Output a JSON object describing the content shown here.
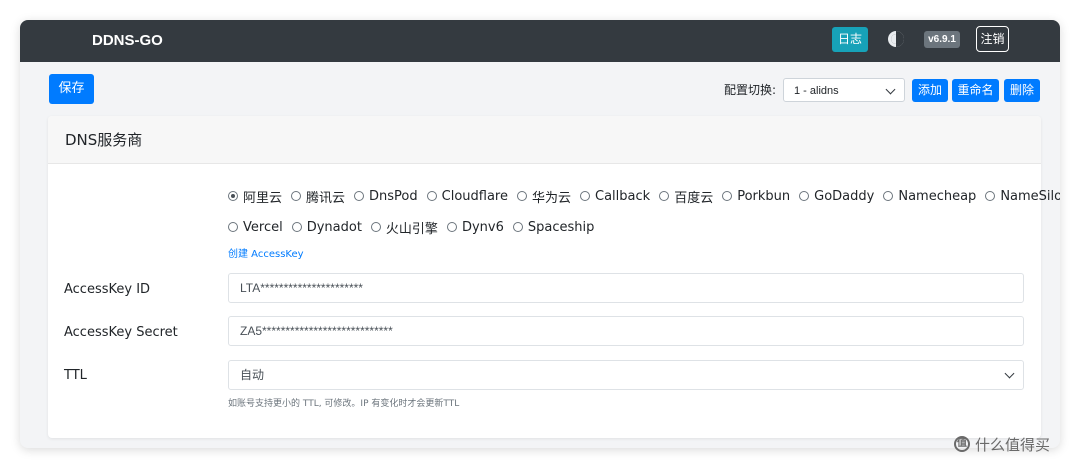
{
  "navbar": {
    "brand": "DDNS-GO",
    "log_label": "日志",
    "version": "v6.9.1",
    "logout_label": "注销",
    "theme_icon": "theme-toggle-icon"
  },
  "toolbar": {
    "save_label": "保存",
    "config_label": "配置切换:",
    "config_selected": "1 - alidns",
    "add_label": "添加",
    "rename_label": "重命名",
    "delete_label": "删除"
  },
  "dns_card": {
    "title": "DNS服务商",
    "providers_row1": [
      {
        "label": "阿里云",
        "checked": true
      },
      {
        "label": "腾讯云",
        "checked": false
      },
      {
        "label": "DnsPod",
        "checked": false
      },
      {
        "label": "Cloudflare",
        "checked": false
      },
      {
        "label": "华为云",
        "checked": false
      },
      {
        "label": "Callback",
        "checked": false
      },
      {
        "label": "百度云",
        "checked": false
      },
      {
        "label": "Porkbun",
        "checked": false
      },
      {
        "label": "GoDaddy",
        "checked": false
      },
      {
        "label": "Namecheap",
        "checked": false
      },
      {
        "label": "NameSilo",
        "checked": false
      }
    ],
    "providers_row2": [
      {
        "label": "Vercel",
        "checked": false
      },
      {
        "label": "Dynadot",
        "checked": false
      },
      {
        "label": "火山引擎",
        "checked": false
      },
      {
        "label": "Dynv6",
        "checked": false
      },
      {
        "label": "Spaceship",
        "checked": false
      }
    ],
    "create_link": "创建 AccessKey",
    "access_key_id_label": "AccessKey ID",
    "access_key_id_value": "LTA**********************",
    "access_key_secret_label": "AccessKey Secret",
    "access_key_secret_value": "ZA5****************************",
    "ttl_label": "TTL",
    "ttl_value": "自动",
    "hint": "如账号支持更小的 TTL, 可修改。IP 有变化时才会更新TTL"
  },
  "watermark": {
    "text": "什么值得买",
    "icon_char": "值"
  }
}
